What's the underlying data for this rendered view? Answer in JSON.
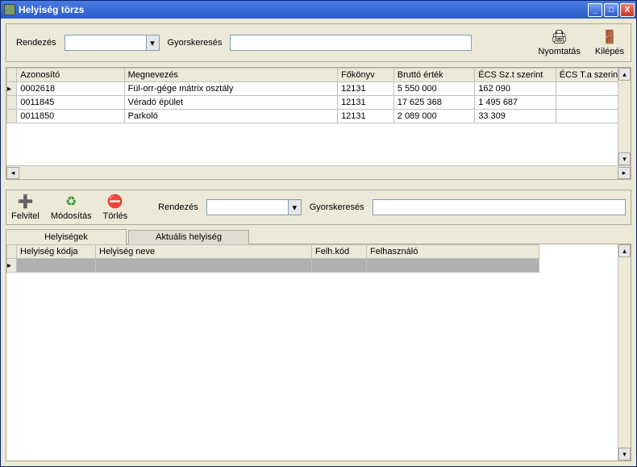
{
  "window": {
    "title": "Helyiség törzs"
  },
  "controls": {
    "minimize": "_",
    "maximize": "□",
    "close": "X"
  },
  "toolbar1": {
    "sort_label": "Rendezés",
    "sort_value": "",
    "search_label": "Gyorskeresés",
    "search_value": "",
    "print": "Nyomtatás",
    "exit": "Kilépés"
  },
  "upper_grid": {
    "columns": [
      "Azonosító",
      "Megnevezés",
      "Főkönyv",
      "Bruttó érték",
      "ÉCS Sz.t szerint",
      "ÉCS T.a szerint"
    ],
    "rows": [
      {
        "id": "0002618",
        "name": "Fül-orr-gége mátrix osztály",
        "ledger": "12131",
        "gross": "5 550 000",
        "depr_szt": "162 090",
        "depr_ta": ""
      },
      {
        "id": "0011845",
        "name": "Véradó épület",
        "ledger": "12131",
        "gross": "17 625 368",
        "depr_szt": "1 495 687",
        "depr_ta": ""
      },
      {
        "id": "0011850",
        "name": "Parkoló",
        "ledger": "12131",
        "gross": "2 089 000",
        "depr_szt": "33 309",
        "depr_ta": ""
      }
    ]
  },
  "toolbar2": {
    "add": "Felvitel",
    "edit": "Módosítás",
    "delete": "Törlés",
    "sort_label": "Rendezés",
    "sort_value": "",
    "search_label": "Gyorskeresés",
    "search_value": ""
  },
  "tabs": {
    "rooms": "Helyiségek",
    "current_room": "Aktuális helyiség"
  },
  "lower_grid": {
    "columns": [
      "Helyiség kódja",
      "Helyiség neve",
      "Felh.kód",
      "Felhasználó"
    ]
  }
}
